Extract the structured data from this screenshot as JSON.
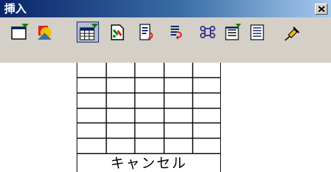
{
  "window": {
    "title": "挿入"
  },
  "toolbar": {
    "buttons": [
      {
        "name": "insert-frame",
        "icon": "frame-icon"
      },
      {
        "name": "insert-shape",
        "icon": "shapes-icon"
      },
      {
        "name": "insert-table",
        "icon": "table-grid-icon",
        "active": true
      },
      {
        "name": "insert-object",
        "icon": "object-icon"
      },
      {
        "name": "insert-field-left",
        "icon": "field-insert-icon"
      },
      {
        "name": "insert-field-right",
        "icon": "field-insert-alt-icon"
      },
      {
        "name": "insert-special-character",
        "icon": "command-symbol-icon"
      },
      {
        "name": "insert-document",
        "icon": "document-icon"
      },
      {
        "name": "insert-list",
        "icon": "list-icon"
      },
      {
        "name": "insert-pin",
        "icon": "pushpin-icon"
      }
    ]
  },
  "table_picker": {
    "rows": 6,
    "columns": 5,
    "cancel_label": "キャンセル"
  }
}
